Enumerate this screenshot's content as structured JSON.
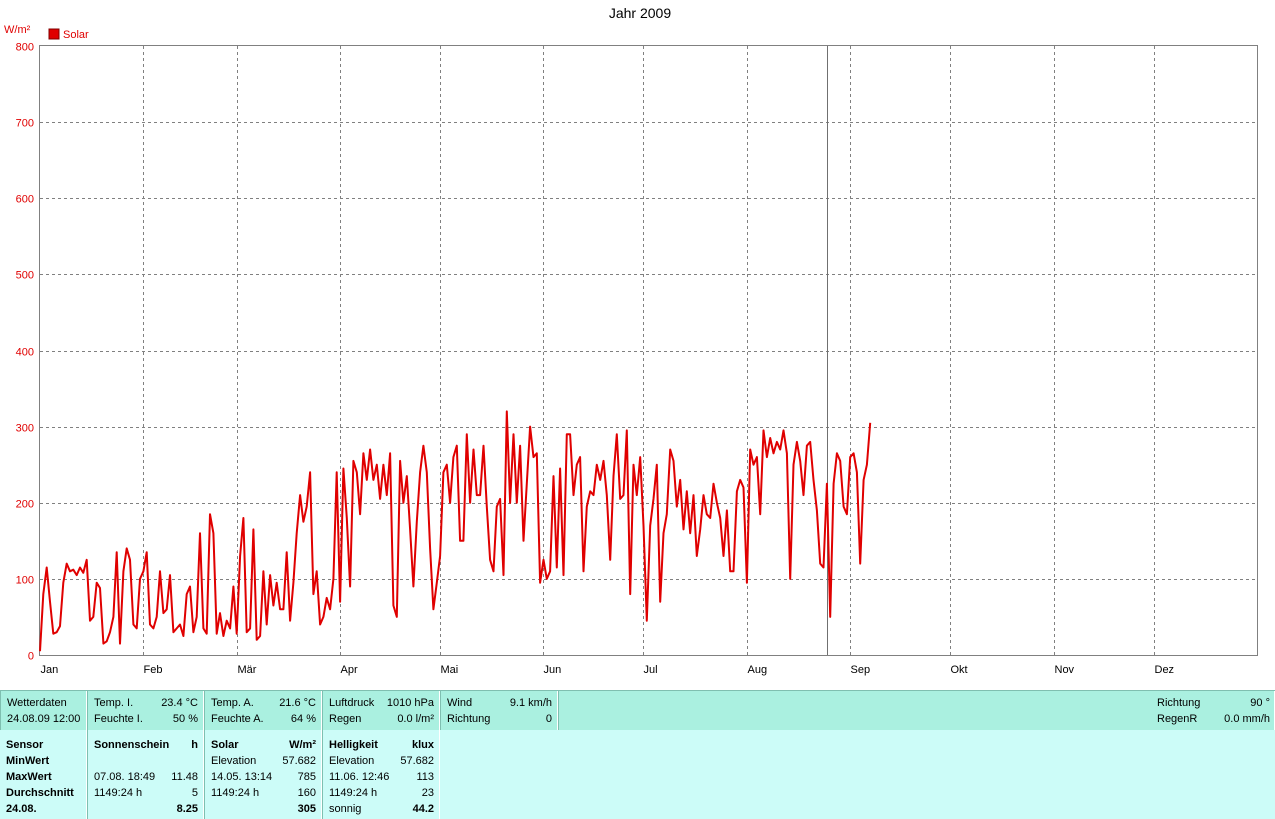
{
  "chart_data": {
    "type": "line",
    "title": "Jahr 2009",
    "ylabel": "W/m²",
    "ylim": [
      0,
      800
    ],
    "yticks": [
      0,
      100,
      200,
      300,
      400,
      500,
      600,
      700,
      800
    ],
    "month_labels": [
      "Jan",
      "Feb",
      "Mär",
      "Apr",
      "Mai",
      "Jun",
      "Jul",
      "Aug",
      "Sep",
      "Okt",
      "Nov",
      "Dez"
    ],
    "month_days": [
      31,
      28,
      31,
      30,
      31,
      30,
      31,
      31,
      30,
      31,
      30,
      31
    ],
    "legend": "Solar",
    "legend_position": "top-left",
    "grid": true,
    "current_day": 236,
    "series": [
      {
        "name": "Solar",
        "color": "#e00000",
        "values": [
          5,
          80,
          115,
          70,
          28,
          30,
          38,
          95,
          120,
          110,
          112,
          105,
          115,
          108,
          125,
          45,
          50,
          95,
          88,
          15,
          18,
          30,
          50,
          135,
          15,
          110,
          140,
          125,
          40,
          35,
          100,
          110,
          135,
          40,
          35,
          50,
          110,
          55,
          60,
          105,
          30,
          35,
          40,
          25,
          80,
          90,
          30,
          50,
          160,
          35,
          28,
          185,
          160,
          28,
          55,
          25,
          45,
          35,
          90,
          28,
          130,
          180,
          30,
          35,
          165,
          20,
          25,
          110,
          40,
          105,
          65,
          95,
          60,
          60,
          135,
          45,
          95,
          160,
          210,
          175,
          195,
          240,
          80,
          110,
          40,
          50,
          75,
          60,
          100,
          240,
          70,
          245,
          180,
          90,
          255,
          240,
          185,
          265,
          230,
          270,
          230,
          250,
          205,
          250,
          210,
          265,
          65,
          50,
          255,
          200,
          235,
          165,
          90,
          175,
          240,
          275,
          240,
          140,
          60,
          95,
          130,
          240,
          250,
          200,
          260,
          275,
          150,
          150,
          290,
          200,
          270,
          210,
          210,
          275,
          195,
          125,
          110,
          195,
          205,
          105,
          320,
          200,
          290,
          200,
          275,
          150,
          225,
          300,
          260,
          265,
          95,
          125,
          100,
          110,
          235,
          115,
          245,
          105,
          290,
          290,
          210,
          250,
          260,
          110,
          195,
          215,
          210,
          250,
          230,
          255,
          210,
          125,
          235,
          290,
          205,
          210,
          295,
          80,
          250,
          210,
          260,
          170,
          45,
          170,
          205,
          250,
          70,
          160,
          185,
          270,
          255,
          195,
          230,
          165,
          215,
          160,
          210,
          130,
          165,
          210,
          185,
          180,
          225,
          200,
          180,
          130,
          190,
          110,
          110,
          215,
          230,
          220,
          95,
          270,
          250,
          260,
          185,
          295,
          260,
          285,
          265,
          280,
          270,
          295,
          265,
          100,
          250,
          280,
          255,
          210,
          275,
          280,
          230,
          190,
          120,
          115,
          225,
          50,
          225,
          265,
          255,
          195,
          185,
          260,
          265,
          240,
          120,
          230,
          250,
          305
        ]
      }
    ]
  },
  "weather": {
    "c1": {
      "l1": "Wetterdaten",
      "l2": "24.08.09 12:00"
    },
    "c2": {
      "k1": "Temp. I.",
      "v1": "23.4 °C",
      "k2": "Feuchte I.",
      "v2": "50 %"
    },
    "c3": {
      "k1": "Temp. A.",
      "v1": "21.6 °C",
      "k2": "Feuchte A.",
      "v2": "64 %"
    },
    "c4": {
      "k1": "Luftdruck",
      "v1": "1010 hPa",
      "k2": "Regen",
      "v2": "0.0 l/m²"
    },
    "c5": {
      "k1": "Wind",
      "v1": "9.1 km/h",
      "k2": "Richtung",
      "v2": "0"
    },
    "c6": {
      "k1": "Richtung",
      "v1": "90 °",
      "k2": "RegenR",
      "v2": "0.0 mm/h"
    }
  },
  "sensor": {
    "labels": [
      "Sensor",
      "MinWert",
      "MaxWert",
      "Durchschnitt",
      "24.08."
    ],
    "sun": {
      "title": "Sonnenschein",
      "unit": "h",
      "max_time": "07.08.  18:49",
      "max_val": "11.48",
      "avg_time": "1149:24 h",
      "avg_val": "5",
      "today": "8.25"
    },
    "solar": {
      "title": "Solar",
      "unit": "W/m²",
      "min_label": "Elevation",
      "min_val": "57.682",
      "max_time": "14.05.  13:14",
      "max_val": "785",
      "avg_time": "1149:24 h",
      "avg_val": "160",
      "today": "305"
    },
    "bright": {
      "title": "Helligkeit",
      "unit": "klux",
      "min_label": "Elevation",
      "min_val": "57.682",
      "max_time": "11.06.  12:46",
      "max_val": "113",
      "avg_time": "1149:24 h",
      "avg_val": "23",
      "today_label": "sonnig",
      "today": "44.2"
    }
  }
}
